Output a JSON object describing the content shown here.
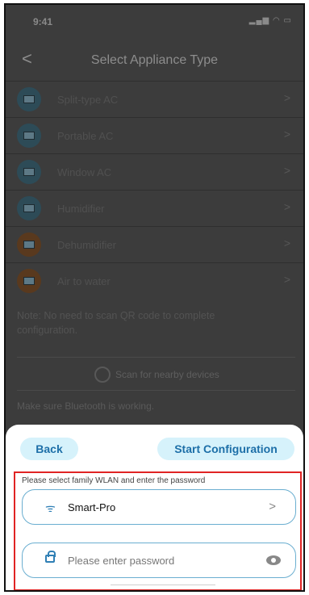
{
  "status_bar": {
    "time": "9:41",
    "signal_icon": "signal-icon",
    "wifi_icon": "wifi-icon",
    "battery_icon": "battery-icon"
  },
  "nav": {
    "back_icon": "chevron-left-icon",
    "back_glyph": "<",
    "title": "Select Appliance Type"
  },
  "appliances": [
    {
      "label": "Split-type AC",
      "icon": "split-ac-icon"
    },
    {
      "label": "Portable AC",
      "icon": "portable-ac-icon"
    },
    {
      "label": "Window AC",
      "icon": "window-ac-icon"
    },
    {
      "label": "Humidifier",
      "icon": "humidifier-icon"
    },
    {
      "label": "Dehumidifier",
      "icon": "dehumidifier-icon"
    },
    {
      "label": "Air to water",
      "icon": "air-to-water-icon"
    }
  ],
  "chevron_glyph": ">",
  "note": "Note: No need to scan QR code to complete configuration.",
  "scan": {
    "label": "Scan for nearby devices"
  },
  "bluetooth_note": "Make sure Bluetooth is working.",
  "sheet": {
    "back_label": "Back",
    "start_label": "Start Configuration",
    "prompt": "Please select family WLAN and enter the password",
    "wlan_value": "Smart-Pro",
    "wlan_arrow": ">",
    "password_placeholder": "Please enter password"
  },
  "colors": {
    "accent": "#1d6fa8",
    "highlight": "#e02424",
    "button_bg": "#d6f2fb"
  }
}
